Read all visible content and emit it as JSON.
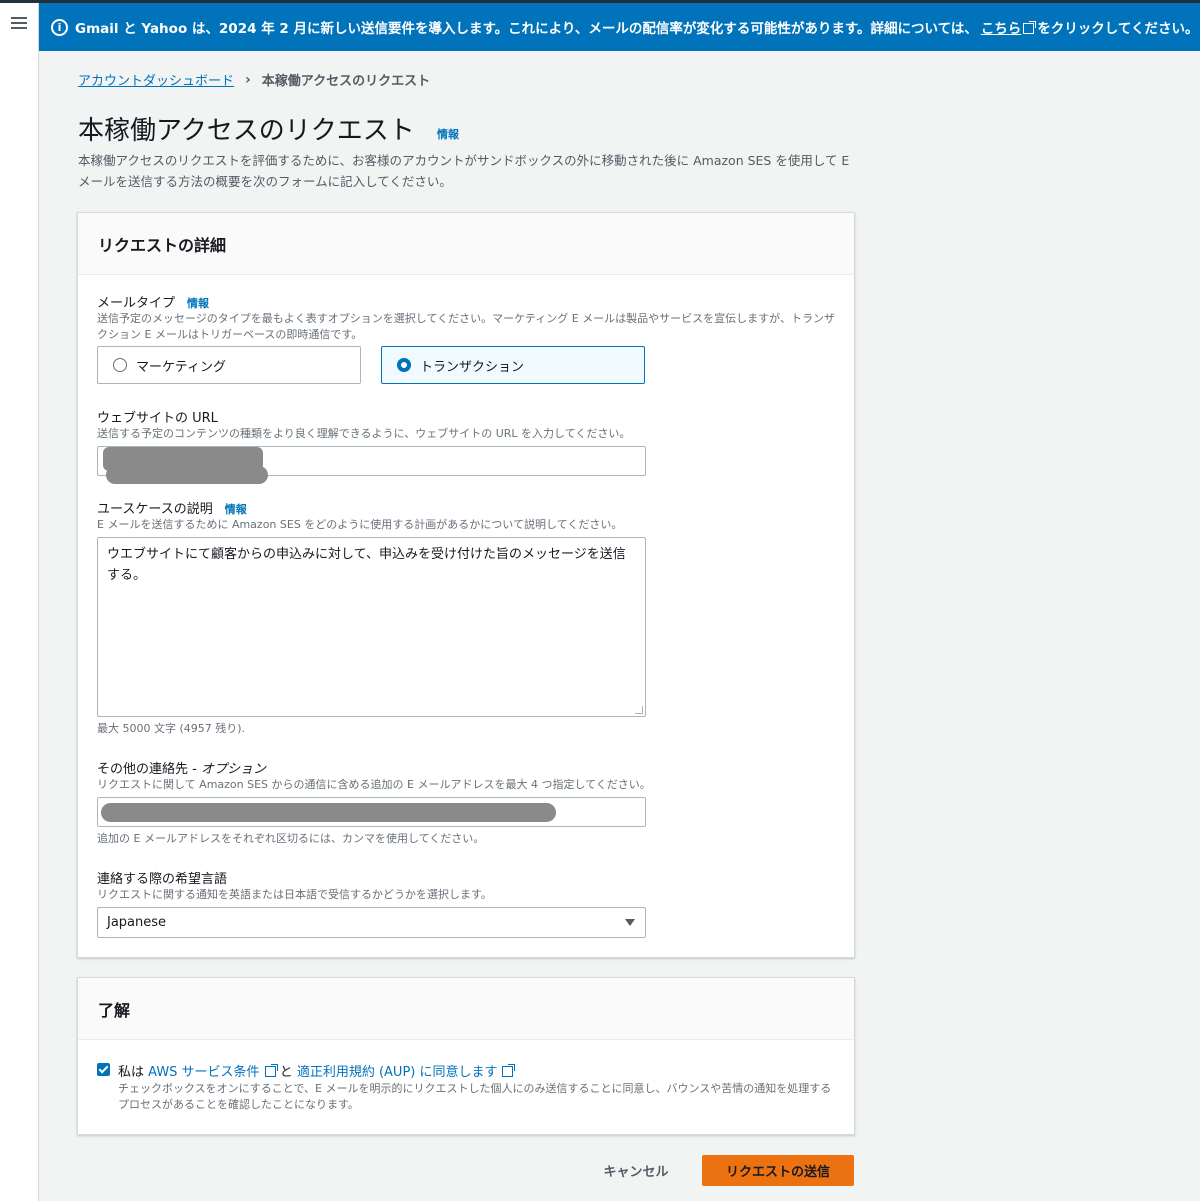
{
  "banner": {
    "text_before": "Gmail と Yahoo は、2024 年 2 月に新しい送信要件を導入します。これにより、メールの配信率が変化する可能性があります。詳細については、",
    "link_label": "こちら",
    "text_after": "をクリックしてください。"
  },
  "breadcrumb": {
    "parent": "アカウントダッシュボード",
    "current": "本稼働アクセスのリクエスト"
  },
  "page": {
    "title": "本稼働アクセスのリクエスト",
    "info": "情報",
    "description": "本稼働アクセスのリクエストを評価するために、お客様のアカウントがサンドボックスの外に移動された後に Amazon SES を使用して E メールを送信する方法の概要を次のフォームに記入してください。"
  },
  "request_details": {
    "header": "リクエストの詳細",
    "mail_type": {
      "label": "メールタイプ",
      "info": "情報",
      "description": "送信予定のメッセージのタイプを最もよく表すオプションを選択してください。マーケティング E メールは製品やサービスを宣伝しますが、トランザクション E メールはトリガーベースの即時通信です。",
      "options": [
        "マーケティング",
        "トランザクション"
      ],
      "selected": "トランザクション"
    },
    "website_url": {
      "label": "ウェブサイトの URL",
      "description": "送信する予定のコンテンツの種類をより良く理解できるように、ウェブサイトの URL を入力してください。"
    },
    "use_case": {
      "label": "ユースケースの説明",
      "info": "情報",
      "description": "E メールを送信するために Amazon SES をどのように使用する計画があるかについて説明してください。",
      "value": "ウエブサイトにて顧客からの申込みに対して、申込みを受け付けた旨のメッセージを送信する。",
      "counter": "最大 5000 文字 (4957 残り)."
    },
    "other_contacts": {
      "label": "その他の連絡先 - ",
      "label_optional": "オプション",
      "description": "リクエストに関して Amazon SES からの通信に含める追加の E メールアドレスを最大 4 つ指定してください。",
      "hint": "追加の E メールアドレスをそれぞれ区切るには、カンマを使用してください。"
    },
    "language": {
      "label": "連絡する際の希望言語",
      "description": "リクエストに関する通知を英語または日本語で受信するかどうかを選択します。",
      "value": "Japanese"
    }
  },
  "acknowledgement": {
    "header": "了解",
    "agree_prefix": "私は ",
    "terms_link": "AWS サービス条件",
    "agree_and": " と ",
    "aup_link": "適正利用規約 (AUP) に同意します",
    "description": "チェックボックスをオンにすることで、E メールを明示的にリクエストした個人にのみ送信することに同意し、バウンスや苦情の通知を処理するプロセスがあることを確認したことになります。",
    "checked": true
  },
  "actions": {
    "cancel": "キャンセル",
    "submit": "リクエストの送信"
  },
  "colors": {
    "accent": "#0073bb",
    "primary_button": "#ec7211",
    "banner": "#0073bb"
  }
}
